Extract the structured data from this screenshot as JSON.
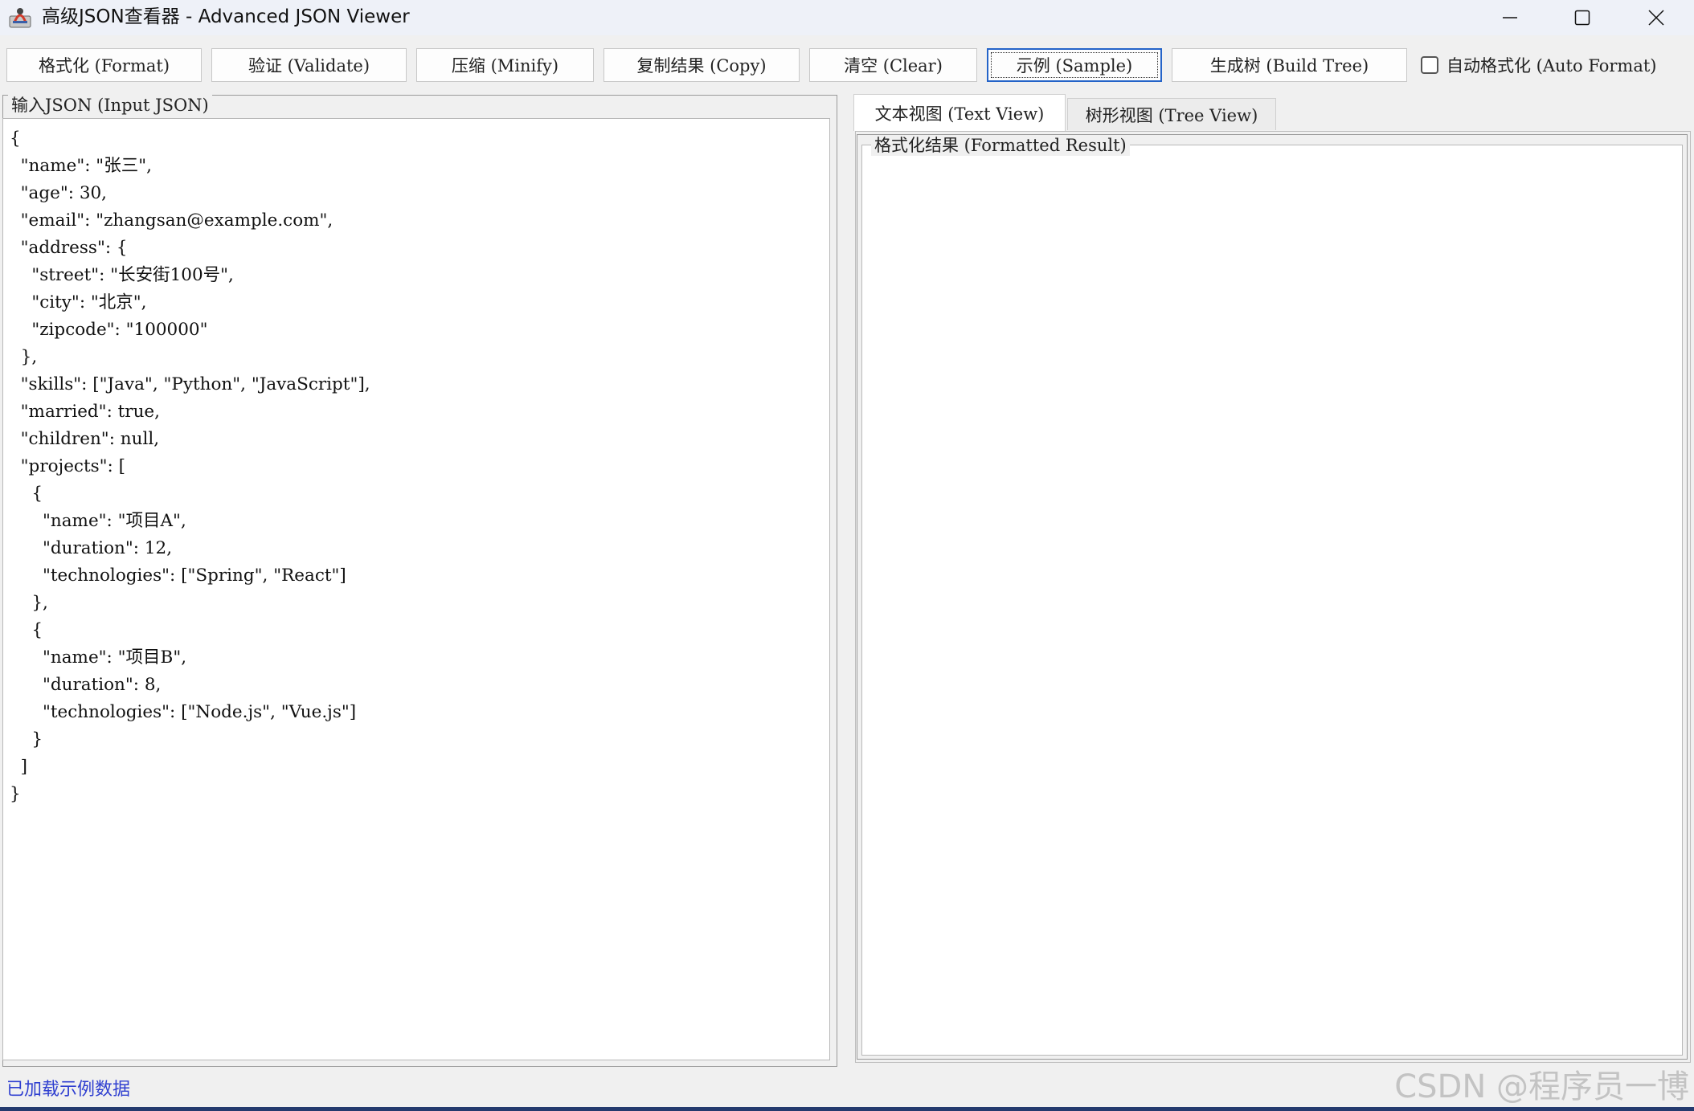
{
  "window": {
    "title": "高级JSON查看器 - Advanced JSON Viewer"
  },
  "toolbar": {
    "format_label": "格式化 (Format)",
    "validate_label": "验证 (Validate)",
    "minify_label": "压缩 (Minify)",
    "copy_label": "复制结果 (Copy)",
    "clear_label": "清空 (Clear)",
    "sample_label": "示例 (Sample)",
    "build_tree_label": "生成树 (Build Tree)",
    "auto_format_label": "自动格式化 (Auto Format)",
    "auto_format_checked": false
  },
  "input_panel": {
    "legend": "输入JSON (Input JSON)",
    "content": "{\n  \"name\": \"张三\",\n  \"age\": 30,\n  \"email\": \"zhangsan@example.com\",\n  \"address\": {\n    \"street\": \"长安街100号\",\n    \"city\": \"北京\",\n    \"zipcode\": \"100000\"\n  },\n  \"skills\": [\"Java\", \"Python\", \"JavaScript\"],\n  \"married\": true,\n  \"children\": null,\n  \"projects\": [\n    {\n      \"name\": \"项目A\",\n      \"duration\": 12,\n      \"technologies\": [\"Spring\", \"React\"]\n    },\n    {\n      \"name\": \"项目B\",\n      \"duration\": 8,\n      \"technologies\": [\"Node.js\", \"Vue.js\"]\n    }\n  ]\n}"
  },
  "tabs": [
    {
      "label": "文本视图 (Text View)",
      "selected": true
    },
    {
      "label": "树形视图 (Tree View)",
      "selected": false
    }
  ],
  "output_panel": {
    "legend": "格式化结果 (Formatted Result)",
    "content": ""
  },
  "status_bar": {
    "message": "已加载示例数据"
  },
  "watermark": "CSDN @程序员一博",
  "colors": {
    "status_text": "#2f3fd0",
    "focus_border": "#2463c8"
  }
}
